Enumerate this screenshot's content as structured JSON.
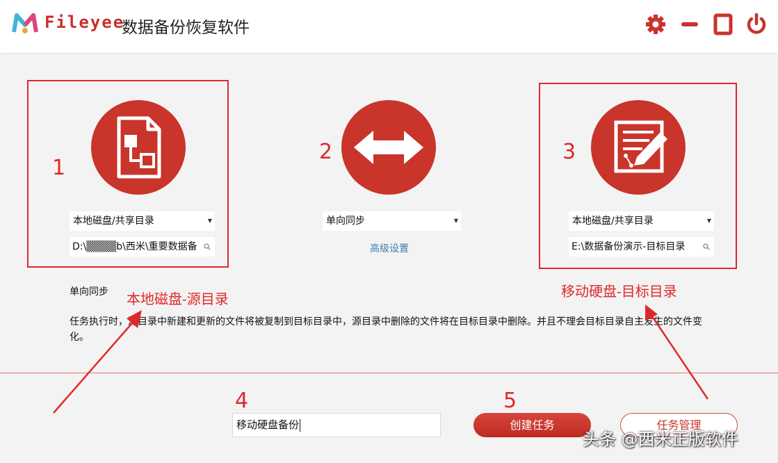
{
  "header": {
    "brand": "Fileyee",
    "title": "数据备份恢复软件"
  },
  "source": {
    "select_value": "本地磁盘/共享目录",
    "path_value": "D:\\▒▒▒▒b\\西米\\重要数据备"
  },
  "sync": {
    "select_value": "单向同步",
    "advanced_link": "高级设置"
  },
  "target": {
    "select_value": "本地磁盘/共享目录",
    "path_value": "E:\\数据备份演示-目标目录"
  },
  "mode": {
    "title": "单向同步",
    "description": "任务执行时，源目录中新建和更新的文件将被复制到目标目录中，源目录中删除的文件将在目标目录中删除。并且不理会目标目录自主发生的文件变化。"
  },
  "task": {
    "name_value": "移动硬盘备份",
    "create_label": "创建任务",
    "manage_label": "任务管理"
  },
  "annotations": {
    "num1": "1",
    "num2": "2",
    "num3": "3",
    "num4": "4",
    "num5": "5",
    "source_label": "本地磁盘-源目录",
    "target_label": "移动硬盘-目标目录"
  },
  "watermark": "头条 @西米正版软件",
  "icons": {
    "source": "document-flow-icon",
    "sync": "double-arrow-icon",
    "target": "edit-document-icon"
  },
  "colors": {
    "accent": "#c9342b",
    "annotation": "#e0282a",
    "link": "#3d7eb0"
  }
}
